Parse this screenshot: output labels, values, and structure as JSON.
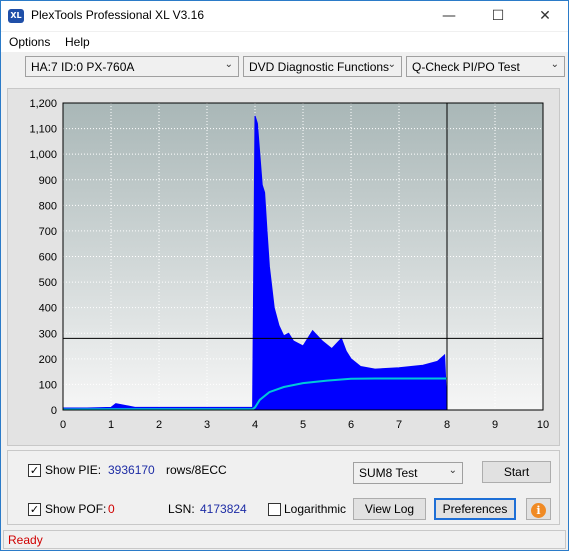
{
  "window": {
    "title": "PlexTools Professional XL V3.16",
    "icon_text": "XL"
  },
  "title_buttons": {
    "minimize": "—",
    "maximize": "☐",
    "close": "✕"
  },
  "menu": {
    "items": [
      "Options",
      "Help"
    ]
  },
  "toolbar": {
    "drive": "HA:7 ID:0  PX-760A",
    "function": "DVD Diagnostic Functions",
    "test": "Q-Check PI/PO Test"
  },
  "chart_data": {
    "type": "area",
    "xlim": [
      0,
      10
    ],
    "ylim": [
      0,
      1200
    ],
    "x_ticks": [
      "0",
      "1",
      "2",
      "3",
      "4",
      "5",
      "6",
      "7",
      "8",
      "9",
      "10"
    ],
    "y_ticks": [
      "0",
      "100",
      "200",
      "300",
      "400",
      "500",
      "600",
      "700",
      "800",
      "900",
      "1,000",
      "1,100",
      "1,200"
    ],
    "threshold_line": 280,
    "end_marker_x": 8,
    "colors": {
      "bars": "#0000ff",
      "curve": "#00c8d8",
      "plot_bg_top": "#aab8b8",
      "plot_bg_bottom": "#f4f4f4"
    },
    "series": [
      {
        "name": "PIE",
        "x": [
          0,
          0.5,
          1.0,
          1.1,
          1.5,
          2,
          2.5,
          3,
          3.5,
          3.95,
          4.0,
          4.05,
          4.1,
          4.15,
          4.2,
          4.25,
          4.3,
          4.4,
          4.5,
          4.6,
          4.7,
          4.8,
          5.0,
          5.2,
          5.4,
          5.6,
          5.8,
          5.9,
          6.0,
          6.2,
          6.5,
          7.0,
          7.5,
          7.8,
          7.95,
          8.0
        ],
        "values": [
          8,
          8,
          10,
          25,
          10,
          10,
          10,
          10,
          10,
          10,
          1150,
          1120,
          1000,
          880,
          850,
          700,
          560,
          400,
          330,
          290,
          300,
          270,
          250,
          310,
          270,
          240,
          280,
          230,
          200,
          170,
          160,
          165,
          175,
          190,
          215,
          0
        ]
      },
      {
        "name": "SUM8",
        "x": [
          0,
          1,
          2,
          3,
          3.95,
          4.0,
          4.1,
          4.3,
          4.6,
          5.0,
          5.5,
          6.0,
          6.5,
          7.0,
          7.5,
          8.0
        ],
        "values": [
          2,
          3,
          3,
          3,
          3,
          10,
          40,
          70,
          90,
          105,
          115,
          122,
          123,
          123,
          123,
          123
        ]
      }
    ]
  },
  "controls": {
    "show_pie_label": "Show PIE:",
    "show_pie_checked": "✓",
    "pie_value": "3936170",
    "pie_unit": "rows/8ECC",
    "show_pof_label": "Show POF:",
    "show_pof_checked": "✓",
    "pof_value": "0",
    "lsn_label": "LSN:",
    "lsn_value": "4173824",
    "logarithmic_label": "Logarithmic",
    "test_select": "SUM8 Test",
    "start_button": "Start",
    "view_log_button": "View Log",
    "preferences_button": "Preferences",
    "info_icon": "i"
  },
  "status": {
    "text": "Ready"
  }
}
